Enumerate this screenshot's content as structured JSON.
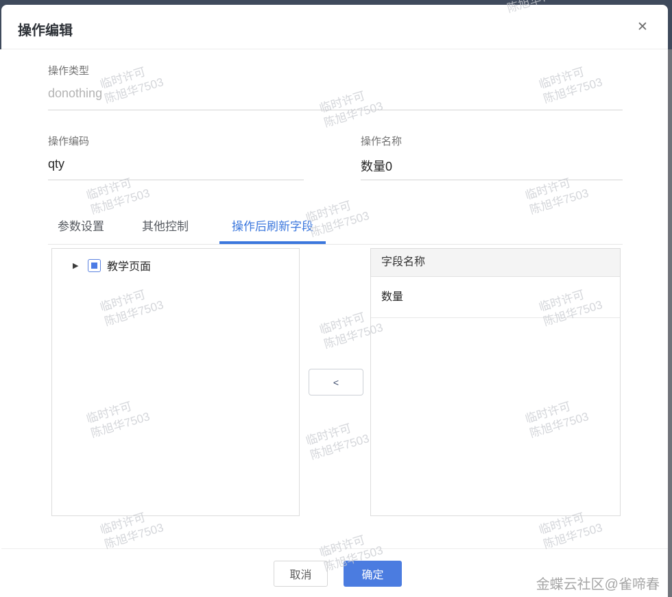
{
  "dialog": {
    "title": "操作编辑",
    "close_icon": "✕"
  },
  "form": {
    "type_label": "操作类型",
    "type_value": "donothing",
    "code_label": "操作编码",
    "code_value": "qty",
    "name_label": "操作名称",
    "name_value": "数量0"
  },
  "tabs": [
    {
      "label": "参数设置",
      "active": false
    },
    {
      "label": "其他控制",
      "active": false
    },
    {
      "label": "操作后刷新字段",
      "active": true
    }
  ],
  "tree": {
    "expand_icon": "▶",
    "node_label": "教学页面"
  },
  "table": {
    "header": "字段名称",
    "rows": [
      "数量"
    ]
  },
  "transfer": {
    "move_left_label": "<"
  },
  "footer": {
    "cancel_label": "取消",
    "confirm_label": "确定"
  },
  "credit": "金蝶云社区@雀啼春",
  "watermark": {
    "line1": "临时许可",
    "line2": "陈旭华7503"
  },
  "colors": {
    "accent": "#3b77dd",
    "confirm_button": "#4b7ce0",
    "chrome_bar": "#3f4a5c"
  }
}
